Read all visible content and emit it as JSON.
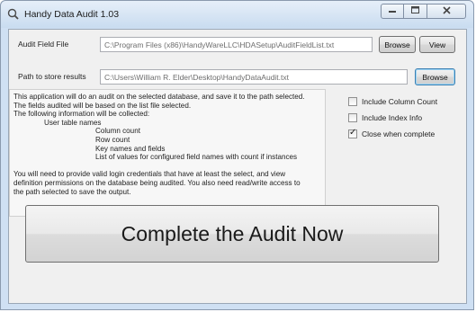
{
  "window": {
    "title": "Handy Data Audit 1.03",
    "icon": "magnifier-icon",
    "buttons": {
      "minimize": "minimize-icon",
      "maximize": "maximize-icon",
      "close": "close-icon"
    }
  },
  "audit_field": {
    "label": "Audit Field File",
    "value": "C:\\Program Files (x86)\\HandyWareLLC\\HDASetup\\AuditFieldList.txt",
    "browse_label": "Browse",
    "view_label": "View"
  },
  "results_path": {
    "label": "Path to store results",
    "value": "C:\\Users\\William R. Elder\\Desktop\\HandyDataAudit.txt",
    "browse_label": "Browse"
  },
  "description": {
    "lines": [
      "This application will do an audit on the selected database, and save it to the path selected.",
      "The fields audited will be based on the list file selected.",
      "The following information will be collected:",
      "User table names",
      "Column count",
      "Row count",
      "Key names and fields",
      "List of values for configured field names with count if instances",
      "",
      "You will need to provide valid login credentials that have at least the select, and view",
      "definition permissions on the database being audited. You also need read/write access to",
      "the path selected to save the output."
    ]
  },
  "options": {
    "include_column_count": {
      "label": "Include Column Count",
      "checked": false
    },
    "include_index_info": {
      "label": "Include Index Info",
      "checked": false
    },
    "close_when_complete": {
      "label": "Close when complete",
      "checked": true
    }
  },
  "actions": {
    "complete_label": "Complete the Audit Now"
  }
}
